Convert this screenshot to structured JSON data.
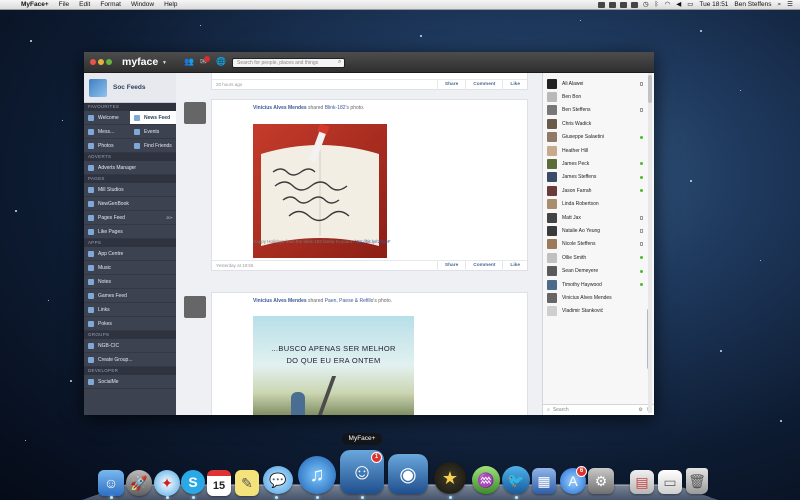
{
  "menubar": {
    "app_name": "MyFace+",
    "menus": [
      "File",
      "Edit",
      "Format",
      "Window",
      "Help"
    ],
    "clock": "Tue 18:51",
    "user": "Ben Steffens"
  },
  "toolbar": {
    "brand": "myface",
    "search_placeholder": "Search for people, places and things"
  },
  "sidebar": {
    "profile_name": "Soc Feeds",
    "sections": [
      {
        "title": "Favourites",
        "rows": [
          [
            {
              "label": "Welcome"
            },
            {
              "label": "News Feed",
              "active": true
            }
          ],
          [
            {
              "label": "Mess..."
            },
            {
              "label": "Events"
            }
          ],
          [
            {
              "label": "Photos"
            },
            {
              "label": "Find Friends"
            }
          ]
        ]
      },
      {
        "title": "Adverts",
        "rows": [
          [
            {
              "label": "Adverts Manager"
            }
          ]
        ]
      },
      {
        "title": "Pages",
        "rows": [
          [
            {
              "label": "Mill Studios"
            }
          ],
          [
            {
              "label": "NewGenBook"
            }
          ],
          [
            {
              "label": "Pages Feed",
              "count": "20+"
            }
          ],
          [
            {
              "label": "Like Pages"
            }
          ]
        ]
      },
      {
        "title": "Apps",
        "rows": [
          [
            {
              "label": "App Centre"
            }
          ],
          [
            {
              "label": "Music"
            }
          ],
          [
            {
              "label": "Notes"
            }
          ],
          [
            {
              "label": "Games Feed"
            }
          ],
          [
            {
              "label": "Links"
            }
          ],
          [
            {
              "label": "Pokes"
            }
          ]
        ]
      },
      {
        "title": "Groups",
        "rows": [
          [
            {
              "label": "NGB-CIC"
            }
          ],
          [
            {
              "label": "Create Group..."
            }
          ]
        ]
      },
      {
        "title": "Developer",
        "rows": [
          [
            {
              "label": "SocialMe"
            }
          ]
        ]
      }
    ]
  },
  "feed": {
    "top_time": "20 hours ago",
    "actions": [
      "Share",
      "Comment",
      "Like"
    ],
    "posts": [
      {
        "author": "Vinicius Alves Mendes",
        "verb": "shared",
        "target": "Blink-182",
        "suffix": "'s photo.",
        "caption": "Happy Holidays from the blink-182 family to yours.",
        "caption_url": "http://bit.ly/rZbyeF",
        "time": "Yesterday at 19:55"
      },
      {
        "author": "Vinicius Alves Mendes",
        "verb": "shared",
        "target": "Paen, Paese & Refillo",
        "suffix": "'s photo.",
        "image_text_line1": "...BUSCO APENAS SER MELHOR",
        "image_text_line2": "DO QUE EU ERA ONTEM"
      }
    ]
  },
  "friends": {
    "list": [
      {
        "name": "Ali Alawei",
        "status": "mobile"
      },
      {
        "name": "Ben Bon",
        "status": ""
      },
      {
        "name": "Ben Steffens",
        "status": "mobile"
      },
      {
        "name": "Chris Wadick",
        "status": ""
      },
      {
        "name": "Giuseppe Salaetini",
        "status": "online"
      },
      {
        "name": "Heather Hill",
        "status": ""
      },
      {
        "name": "James Peck",
        "status": "online"
      },
      {
        "name": "James Steffens",
        "status": "online"
      },
      {
        "name": "Jason Farrah",
        "status": "online"
      },
      {
        "name": "Linda Robertson",
        "status": ""
      },
      {
        "name": "Matt Jax",
        "status": "mobile"
      },
      {
        "name": "Natalie Ao Yeung",
        "status": "mobile"
      },
      {
        "name": "Nicole Steffens",
        "status": "mobile"
      },
      {
        "name": "Ollie Smith",
        "status": "online"
      },
      {
        "name": "Sean Demeyere",
        "status": "online"
      },
      {
        "name": "Timothy Haywood",
        "status": "online"
      },
      {
        "name": "Vinicius Alves Mendes",
        "status": ""
      },
      {
        "name": "Vladimir Stanković",
        "status": ""
      }
    ],
    "search_label": "Search"
  },
  "dock": {
    "tooltip": "MyFace+",
    "calendar_day": "15",
    "myface_badge": "1",
    "appstore_badge": "6"
  }
}
